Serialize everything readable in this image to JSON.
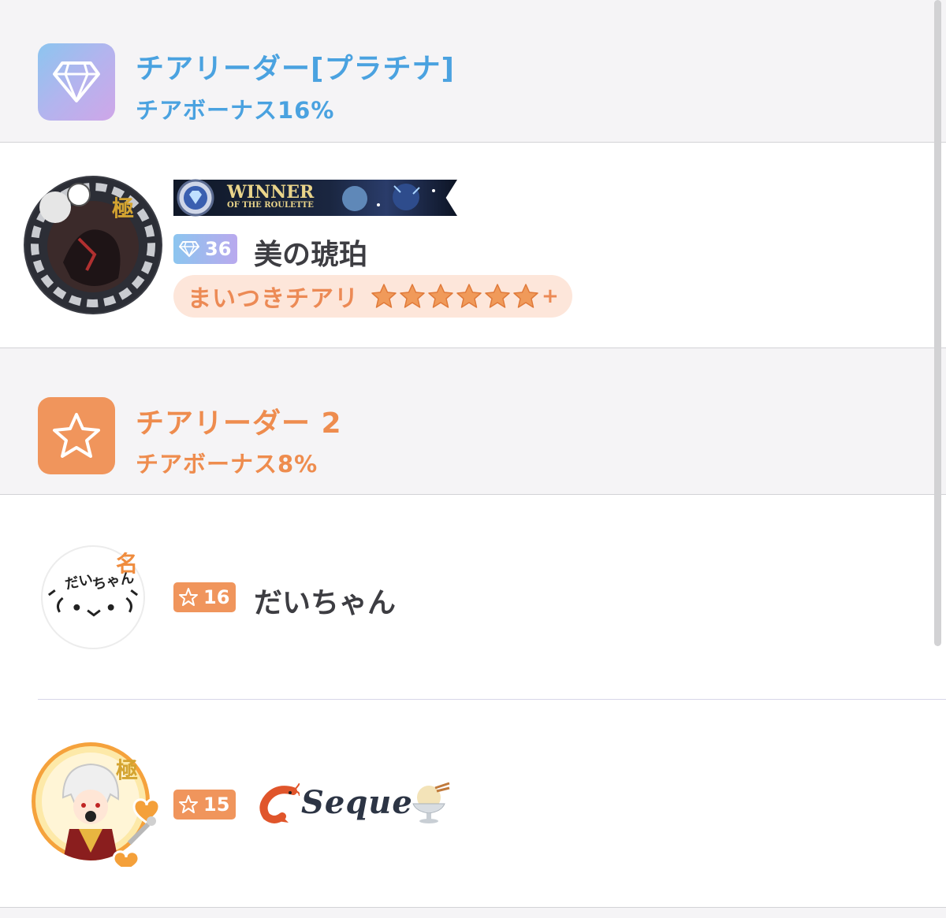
{
  "sections": [
    {
      "title": "チアリーダー[プラチナ]",
      "bonus": "チアボーナス16%",
      "icon": "diamond-icon",
      "color": "#4aa2e0"
    },
    {
      "title": "チアリーダー 2",
      "bonus": "チアボーナス8%",
      "icon": "star-icon",
      "color": "#ee8c4e"
    }
  ],
  "users": [
    {
      "level": "36",
      "name": "美の琥珀",
      "avatar_badge": "極",
      "banner_title": "WINNER",
      "banner_subtitle": "OF THE ROULETTE",
      "chip_label": "まいつきチアリ",
      "chip_stars": 6,
      "chip_plus": "+"
    },
    {
      "level": "16",
      "name": "だいちゃん",
      "avatar_badge": "名",
      "avatar_text": "だいちゃん"
    },
    {
      "level": "15",
      "name": "Seque",
      "avatar_badge": "極",
      "prefix_emoji": "shrimp-icon",
      "suffix_emoji": "ice-cream-icon"
    }
  ]
}
